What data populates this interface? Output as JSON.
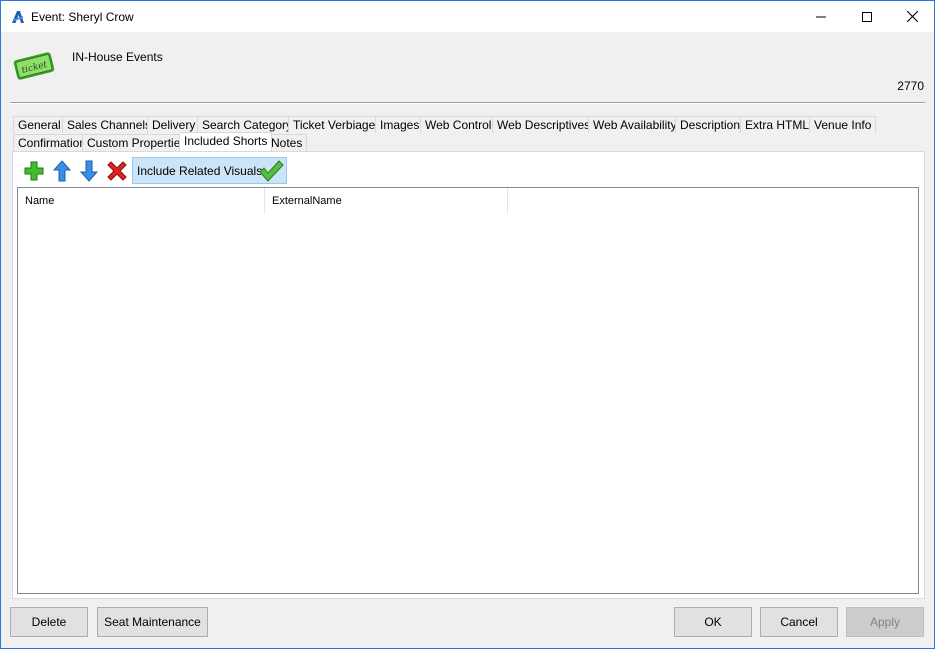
{
  "window": {
    "title": "Event: Sheryl Crow"
  },
  "header": {
    "category": "IN-House Events",
    "event_id": "2770",
    "ticket_icon_text": "ticket"
  },
  "tabs_row1": [
    {
      "label": "General"
    },
    {
      "label": "Sales Channels"
    },
    {
      "label": "Delivery"
    },
    {
      "label": "Search Category"
    },
    {
      "label": "Ticket Verbiage"
    },
    {
      "label": "Images"
    },
    {
      "label": "Web Control"
    },
    {
      "label": "Web Descriptives"
    },
    {
      "label": "Web Availability"
    },
    {
      "label": "Description"
    },
    {
      "label": "Extra HTML"
    },
    {
      "label": "Venue Info"
    }
  ],
  "tabs_row2": [
    {
      "label": "Confirmation"
    },
    {
      "label": "Custom Properties"
    },
    {
      "label": "Included Shorts"
    },
    {
      "label": "Notes"
    }
  ],
  "active_tab": "Included Shorts",
  "toolbar": {
    "add_icon": "plus-icon",
    "up_icon": "arrow-up-icon",
    "down_icon": "arrow-down-icon",
    "delete_icon": "delete-x-icon",
    "include_label": "Include Related Visuals",
    "include_checked": true
  },
  "grid": {
    "columns": [
      {
        "label": "Name"
      },
      {
        "label": "ExternalName"
      }
    ],
    "rows": []
  },
  "buttons": {
    "delete": "Delete",
    "seat_maintenance": "Seat Maintenance",
    "ok": "OK",
    "cancel": "Cancel",
    "apply": "Apply"
  },
  "colors": {
    "accent": "#2b79d6",
    "include_bg": "#cce4f7"
  }
}
